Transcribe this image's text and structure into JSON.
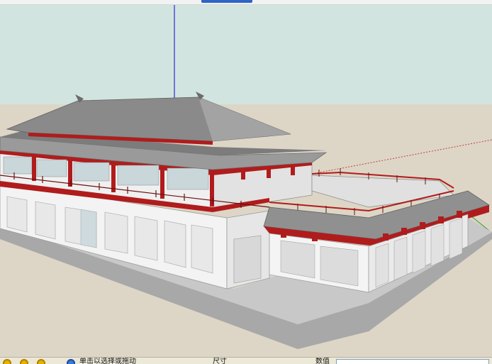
{
  "app": {
    "statusbar": {
      "hint_text": "单击以选择或拖动",
      "mid_text": "尺寸",
      "measure_label": "数值",
      "measure_value": ""
    }
  },
  "colors": {
    "sky": "#d2e4e0",
    "ground": "#ddd6c7",
    "roof": "#8e8e8e",
    "roof_dark": "#6c6c6c",
    "wall": "#f3f3f3",
    "red_trim": "#b01c1c",
    "base": "#b8b8b8",
    "blue_axis": "#2a2ad0",
    "green_axis": "#2c9a2c",
    "red_axis": "#c04040"
  },
  "icons": [
    "undo-circle-icon",
    "redo-circle-icon",
    "help-circle-icon",
    "globe-icon"
  ]
}
